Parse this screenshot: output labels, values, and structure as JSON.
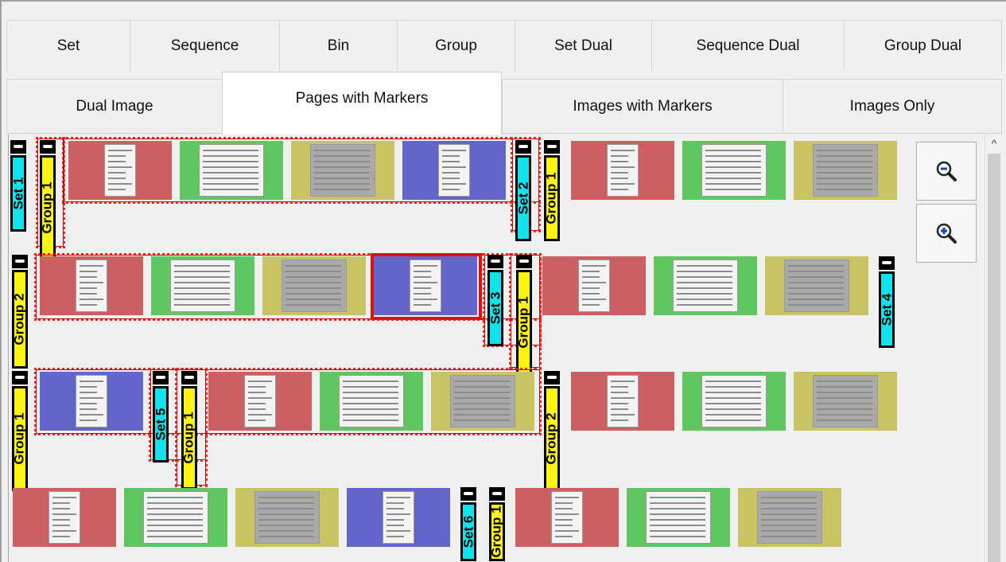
{
  "tabs_row1": [
    "Set",
    "Sequence",
    "Bin",
    "Group",
    "Set Dual",
    "Sequence Dual",
    "Group Dual"
  ],
  "tabs_row2": [
    "Dual Image",
    "Pages with Markers",
    "Images with Markers",
    "Images Only"
  ],
  "active_tab": "Pages with Markers",
  "colors": {
    "red": "#cc5f5f",
    "green": "#60c760",
    "yellow": "#c9c463",
    "blue": "#6465c9",
    "set_marker": "#12e2ee",
    "group_marker": "#fdf511",
    "selection": "#e01010"
  },
  "zoom": {
    "out_icon": "zoom-out-icon",
    "in_icon": "zoom-in-icon"
  },
  "markers": {
    "set1": "Set 1",
    "group1": "Group 1",
    "set2": "Set 2",
    "group2": "Group 2",
    "set3": "Set 3",
    "set4": "Set 4",
    "set5": "Set 5",
    "set6": "Set 6"
  }
}
